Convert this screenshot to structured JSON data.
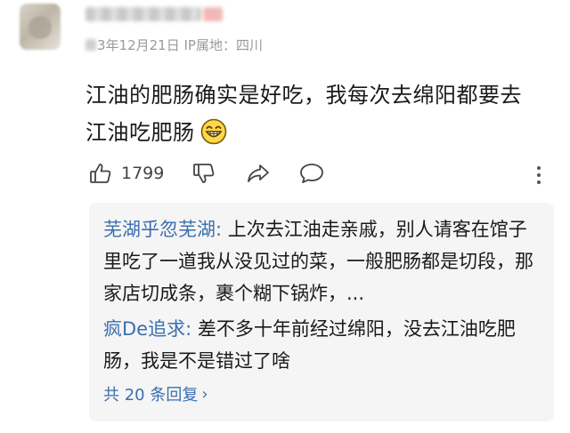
{
  "comment": {
    "meta_date": "3年12月21日",
    "ip_label": "IP属地：四川",
    "text_line1": "江油的肥肠确实是好吃，我每次去绵阳都要去",
    "text_line2": "江油吃肥肠",
    "emoji": "grinning-face"
  },
  "actions": {
    "like_count": "1799"
  },
  "replies": [
    {
      "author": "芜湖乎忽芜湖",
      "colon": ":",
      "text": " 上次去江油走亲戚，别人请客在馆子里吃了一道我从没见过的菜，一般肥肠都是切段，那家店切成条，裹个糊下锅炸，..."
    },
    {
      "author": "疯De追求",
      "colon": ":",
      "text": " 差不多十年前经过绵阳，没去江油吃肥肠，我是不是错过了啥"
    }
  ],
  "more_replies": {
    "label": "共 20 条回复",
    "chevron": "›"
  },
  "colors": {
    "link_blue": "#3a6fb0",
    "reply_bg": "#f5f5f5",
    "meta_gray": "#9a9a9a"
  }
}
